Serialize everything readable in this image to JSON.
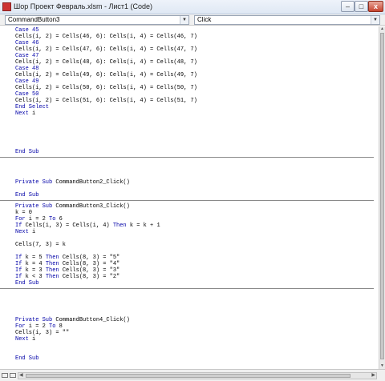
{
  "window": {
    "title": "Шор Проект Февраль.xlsm - Лист1 (Code)",
    "min_label": "–",
    "max_label": "□",
    "close_label": "x"
  },
  "object_combo": {
    "value": "CommandButton3"
  },
  "procedure_combo": {
    "value": "Click"
  },
  "icons": [
    "app-icon",
    "minimize-icon",
    "maximize-icon",
    "close-icon",
    "dropdown-arrow-icon",
    "scroll-up-icon",
    "scroll-down-icon",
    "scroll-left-icon",
    "scroll-right-icon",
    "procedure-view-icon",
    "full-module-view-icon"
  ],
  "colors": {
    "keyword": "#0000a8",
    "text": "#000000",
    "separator": "#8a8a8a"
  },
  "code": {
    "lines": [
      [
        {
          "t": "Case 45",
          "k": 1
        }
      ],
      [
        {
          "t": "Cells(i, 2) = Cells(46, 6): Cells(i, 4) = Cells(46, 7)",
          "k": 0
        }
      ],
      [
        {
          "t": "Case 46",
          "k": 1
        }
      ],
      [
        {
          "t": "Cells(i, 2) = Cells(47, 6): Cells(i, 4) = Cells(47, 7)",
          "k": 0
        }
      ],
      [
        {
          "t": "Case 47",
          "k": 1
        }
      ],
      [
        {
          "t": "Cells(i, 2) = Cells(48, 6): Cells(i, 4) = Cells(48, 7)",
          "k": 0
        }
      ],
      [
        {
          "t": "Case 48",
          "k": 1
        }
      ],
      [
        {
          "t": "Cells(i, 2) = Cells(49, 6): Cells(i, 4) = Cells(49, 7)",
          "k": 0
        }
      ],
      [
        {
          "t": "Case 49",
          "k": 1
        }
      ],
      [
        {
          "t": "Cells(i, 2) = Cells(50, 6): Cells(i, 4) = Cells(50, 7)",
          "k": 0
        }
      ],
      [
        {
          "t": "Case 50",
          "k": 1
        }
      ],
      [
        {
          "t": "Cells(i, 2) = Cells(51, 6): Cells(i, 4) = Cells(51, 7)",
          "k": 0
        }
      ],
      [
        {
          "t": "End Select",
          "k": 1
        }
      ],
      [
        {
          "t": "Next",
          "k": 1
        },
        {
          "t": " i",
          "k": 0
        }
      ],
      [],
      [],
      [],
      [],
      [],
      [
        {
          "t": "End Sub",
          "k": 1
        }
      ],
      "SEP",
      [],
      [],
      [],
      [
        {
          "t": "Private Sub",
          "k": 1
        },
        {
          "t": " CommandButton2_Click()",
          "k": 0
        }
      ],
      [],
      [
        {
          "t": "End Sub",
          "k": 1
        }
      ],
      "SEP",
      [
        {
          "t": "Private Sub",
          "k": 1
        },
        {
          "t": " CommandButton3_Click()",
          "k": 0
        }
      ],
      [
        {
          "t": "k = 0",
          "k": 0
        }
      ],
      [
        {
          "t": "For",
          "k": 1
        },
        {
          "t": " i = 2 ",
          "k": 0
        },
        {
          "t": "To",
          "k": 1
        },
        {
          "t": " 6",
          "k": 0
        }
      ],
      [
        {
          "t": "If",
          "k": 1
        },
        {
          "t": " Cells(i, 3) = Cells(i, 4) ",
          "k": 0
        },
        {
          "t": "Then",
          "k": 1
        },
        {
          "t": " k = k + 1",
          "k": 0
        }
      ],
      [
        {
          "t": "Next",
          "k": 1
        },
        {
          "t": " i",
          "k": 0
        }
      ],
      [],
      [
        {
          "t": "Cells(7, 3) = k",
          "k": 0
        }
      ],
      [],
      [
        {
          "t": "If",
          "k": 1
        },
        {
          "t": " k = 5 ",
          "k": 0
        },
        {
          "t": "Then",
          "k": 1
        },
        {
          "t": " Cells(8, 3) = \"5\"",
          "k": 0
        }
      ],
      [
        {
          "t": "If",
          "k": 1
        },
        {
          "t": " k = 4 ",
          "k": 0
        },
        {
          "t": "Then",
          "k": 1
        },
        {
          "t": " Cells(8, 3) = \"4\"",
          "k": 0
        }
      ],
      [
        {
          "t": "If",
          "k": 1
        },
        {
          "t": " k = 3 ",
          "k": 0
        },
        {
          "t": "Then",
          "k": 1
        },
        {
          "t": " Cells(8, 3) = \"3\"",
          "k": 0
        }
      ],
      [
        {
          "t": "If",
          "k": 1
        },
        {
          "t": " k < 3 ",
          "k": 0
        },
        {
          "t": "Then",
          "k": 1
        },
        {
          "t": " Cells(8, 3) = \"2\"",
          "k": 0
        }
      ],
      [
        {
          "t": "End Sub",
          "k": 1
        }
      ],
      "SEP",
      [],
      [],
      [],
      [],
      [
        {
          "t": "Private Sub",
          "k": 1
        },
        {
          "t": " CommandButton4_Click()",
          "k": 0
        }
      ],
      [
        {
          "t": "For",
          "k": 1
        },
        {
          "t": " i = 2 ",
          "k": 0
        },
        {
          "t": "To",
          "k": 1
        },
        {
          "t": " 8",
          "k": 0
        }
      ],
      [
        {
          "t": "Cells(i, 3) = \"\"",
          "k": 0
        }
      ],
      [
        {
          "t": "Next",
          "k": 1
        },
        {
          "t": " i",
          "k": 0
        }
      ],
      [],
      [],
      [
        {
          "t": "End Sub",
          "k": 1
        }
      ]
    ]
  }
}
